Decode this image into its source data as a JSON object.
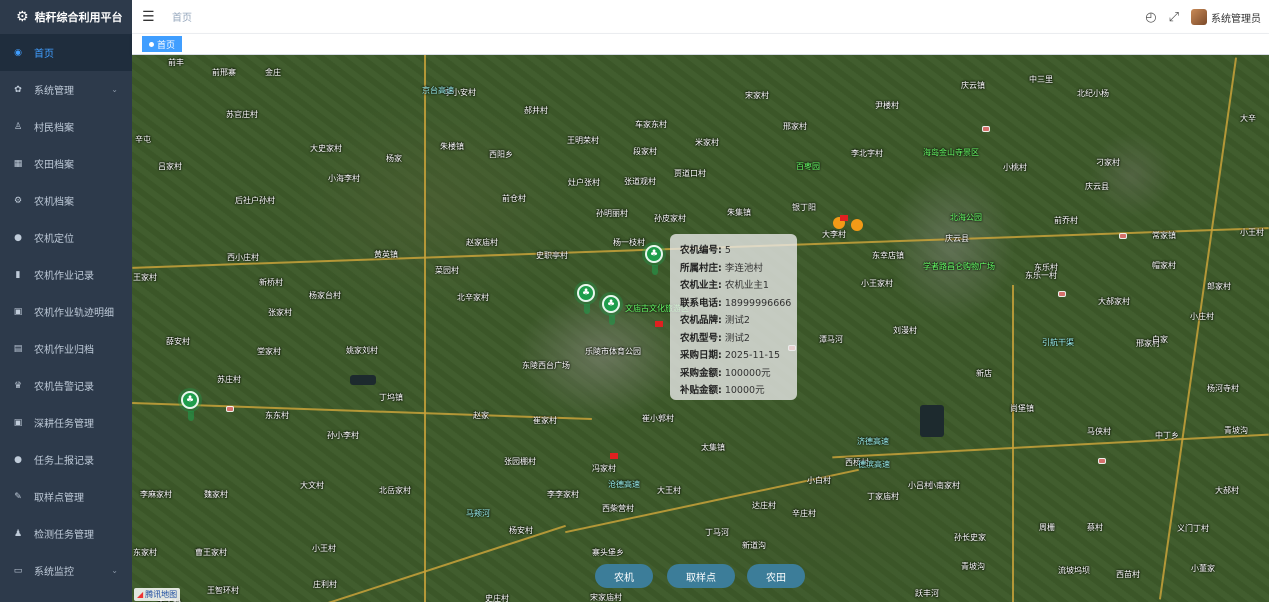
{
  "app": {
    "title": "秸秆综合利用平台"
  },
  "sidebar": {
    "items": [
      {
        "label": "首页",
        "icon": "dashboard-icon"
      },
      {
        "label": "系统管理",
        "icon": "gear-icon",
        "has_children": true
      },
      {
        "label": "村民档案",
        "icon": "user-icon"
      },
      {
        "label": "农田档案",
        "icon": "field-icon"
      },
      {
        "label": "农机档案",
        "icon": "tractor-icon"
      },
      {
        "label": "农机定位",
        "icon": "location-icon"
      },
      {
        "label": "农机作业记录",
        "icon": "chart-icon"
      },
      {
        "label": "农机作业轨迹明细",
        "icon": "clipboard-icon"
      },
      {
        "label": "农机作业归档",
        "icon": "book-icon"
      },
      {
        "label": "农机告警记录",
        "icon": "alarm-icon"
      },
      {
        "label": "深耕任务管理",
        "icon": "clipboard-icon"
      },
      {
        "label": "任务上报记录",
        "icon": "report-icon"
      },
      {
        "label": "取样点管理",
        "icon": "pin-icon"
      },
      {
        "label": "检测任务管理",
        "icon": "inspect-icon"
      },
      {
        "label": "系统监控",
        "icon": "monitor-icon",
        "has_children": true
      }
    ]
  },
  "header": {
    "breadcrumb": "首页",
    "username": "系统管理员"
  },
  "tags": [
    {
      "label": "首页"
    }
  ],
  "map": {
    "popup": {
      "rows": [
        {
          "k": "农机编号:",
          "v": "5"
        },
        {
          "k": "所属村庄:",
          "v": "李连池村"
        },
        {
          "k": "农机业主:",
          "v": "农机业主1"
        },
        {
          "k": "联系电话:",
          "v": "18999996666"
        },
        {
          "k": "农机品牌:",
          "v": "测试2"
        },
        {
          "k": "农机型号:",
          "v": "测试2"
        },
        {
          "k": "采购日期:",
          "v": "2025-11-15"
        },
        {
          "k": "采购金额:",
          "v": "100000元"
        },
        {
          "k": "补贴金额:",
          "v": "10000元"
        }
      ]
    },
    "buttons": {
      "machine": "农机",
      "sample": "取样点",
      "field": "农田"
    },
    "provider_logo": "腾讯地图",
    "places": [
      [
        "前丰",
        36,
        2
      ],
      [
        "前邢寨",
        80,
        12
      ],
      [
        "金庄",
        133,
        12
      ],
      [
        "李小安村",
        312,
        32
      ],
      [
        "郝井村",
        392,
        50
      ],
      [
        "苏官庄村",
        94,
        54
      ],
      [
        "车家东村",
        503,
        64
      ],
      [
        "辛屯",
        3,
        79
      ],
      [
        "大史家村",
        178,
        88
      ],
      [
        "杨家",
        254,
        98
      ],
      [
        "朱楼镇",
        308,
        86
      ],
      [
        "西阳乡",
        357,
        94
      ],
      [
        "王明荣村",
        435,
        80
      ],
      [
        "段家村",
        501,
        91
      ],
      [
        "贾道口村",
        542,
        113
      ],
      [
        "吕家村",
        26,
        106
      ],
      [
        "小海李村",
        196,
        118
      ],
      [
        "灶户张村",
        436,
        122
      ],
      [
        "张道观村",
        492,
        121
      ],
      [
        "后社户孙村",
        103,
        140
      ],
      [
        "前仓村",
        370,
        138
      ],
      [
        "孙明丽村",
        464,
        153
      ],
      [
        "孙皮家村",
        522,
        158
      ],
      [
        "朱集镇",
        595,
        152
      ],
      [
        "银丁阳",
        660,
        147
      ],
      [
        "大李村",
        690,
        174
      ],
      [
        "赵家庙村",
        334,
        182
      ],
      [
        "史职亭村",
        404,
        195
      ],
      [
        "杨一枝村",
        481,
        182
      ],
      [
        "黄英镇",
        242,
        194
      ],
      [
        "西小庄村",
        95,
        197
      ],
      [
        "菜园村",
        303,
        210
      ],
      [
        "北辛家村",
        325,
        237
      ],
      [
        "杨家台村",
        177,
        235
      ],
      [
        "新桥村",
        127,
        222
      ],
      [
        "王家村",
        1,
        217
      ],
      [
        "张家村",
        136,
        252
      ],
      [
        "薛安村",
        34,
        281
      ],
      [
        "堂家村",
        125,
        291
      ],
      [
        "姚家刘村",
        214,
        290
      ],
      [
        "苏庄村",
        85,
        319
      ],
      [
        "丁坞镇",
        247,
        337
      ],
      [
        "赵家",
        341,
        355
      ],
      [
        "崔家村",
        401,
        360
      ],
      [
        "崔小郭村",
        510,
        358
      ],
      [
        "东东村",
        133,
        355
      ],
      [
        "孙小李村",
        195,
        375
      ],
      [
        "张园棚村",
        372,
        401
      ],
      [
        "冯家村",
        460,
        408
      ],
      [
        "大文村",
        168,
        425
      ],
      [
        "北岳家村",
        247,
        430
      ],
      [
        "李李家村",
        415,
        434
      ],
      [
        "西柴营村",
        470,
        448
      ],
      [
        "杨安村",
        377,
        470
      ],
      [
        "寨头堡乡",
        460,
        492
      ],
      [
        "李麻家村",
        8,
        434
      ],
      [
        "魏家村",
        72,
        434
      ],
      [
        "小王村",
        180,
        488
      ],
      [
        "庄利村",
        181,
        524
      ],
      [
        "曹王家村",
        63,
        492
      ],
      [
        "王智环村",
        75,
        530
      ],
      [
        "东家村",
        1,
        492
      ],
      [
        "宋家庙村",
        458,
        537
      ],
      [
        "史庄村",
        353,
        538
      ],
      [
        "丰王村",
        25,
        543
      ],
      [
        "太集镇",
        569,
        387
      ],
      [
        "达庄村",
        620,
        445
      ],
      [
        "大王村",
        525,
        430
      ],
      [
        "辛庄村",
        660,
        453
      ],
      [
        "小白村",
        675,
        420
      ],
      [
        "西桥村",
        713,
        402
      ],
      [
        "宋家村",
        613,
        35
      ],
      [
        "邢家村",
        651,
        66
      ],
      [
        "尹楼村",
        743,
        45
      ],
      [
        "李北字村",
        719,
        93
      ],
      [
        "米家村",
        563,
        82
      ],
      [
        "庆云镇",
        829,
        25
      ],
      [
        "北纪小杨",
        945,
        33
      ],
      [
        "小桃村",
        871,
        107
      ],
      [
        "刁家村",
        964,
        102
      ],
      [
        "庆云县",
        953,
        126
      ],
      [
        "前乔村",
        922,
        160
      ],
      [
        "东幸店镇",
        740,
        195
      ],
      [
        "小王家村",
        729,
        223
      ],
      [
        "刘漫村",
        761,
        270
      ],
      [
        "庆云县",
        813,
        178
      ],
      [
        "潭马河",
        687,
        279
      ],
      [
        "东乐村",
        902,
        207
      ],
      [
        "大郝家村",
        966,
        241
      ],
      [
        "小庄村",
        1058,
        256
      ],
      [
        "邢家村",
        1004,
        283
      ],
      [
        "白家",
        1020,
        279
      ],
      [
        "新店",
        844,
        313
      ],
      [
        "尚堡镇",
        878,
        348
      ],
      [
        "马侠村",
        955,
        371
      ],
      [
        "中丁乡",
        1023,
        375
      ],
      [
        "杨河寺村",
        1075,
        328
      ],
      [
        "小吕村",
        776,
        425
      ],
      [
        "小南家村",
        796,
        425
      ],
      [
        "丁家庙村",
        735,
        436
      ],
      [
        "大郝村",
        1083,
        430
      ],
      [
        "周栅",
        907,
        467
      ],
      [
        "蔡村",
        955,
        467
      ],
      [
        "孙长史家",
        822,
        477
      ],
      [
        "义门丁村",
        1045,
        468
      ],
      [
        "青坡沟",
        829,
        506
      ],
      [
        "流坡坞坝",
        926,
        510
      ],
      [
        "西苗村",
        984,
        514
      ],
      [
        "小董家",
        1059,
        508
      ],
      [
        "跃丰河",
        783,
        533
      ],
      [
        "常家镇",
        1020,
        175
      ],
      [
        "帽家村",
        1020,
        205
      ],
      [
        "郎家村",
        1075,
        226
      ],
      [
        "小王村",
        1108,
        172
      ],
      [
        "大辛",
        1108,
        58
      ],
      [
        "丁马河",
        573,
        472
      ],
      [
        "新道沟",
        610,
        485
      ],
      [
        "乐陵市体育公园",
        453,
        291
      ],
      [
        "东陵西台广场",
        390,
        305
      ],
      [
        "中三里",
        897,
        19
      ],
      [
        "青坡沟",
        1092,
        370
      ],
      [
        "东乐一村",
        893,
        215
      ]
    ],
    "poi_labels": [
      [
        "文庙古文化旅游区",
        493,
        248
      ],
      [
        "百枣园",
        664,
        106
      ],
      [
        "北海公园",
        818,
        157
      ],
      [
        "海岛金山寺景区",
        791,
        92
      ],
      [
        "学者路昌仑购物广场",
        791,
        206
      ]
    ],
    "road_labels": [
      [
        "京台高速",
        290,
        30
      ],
      [
        "沧德高速",
        476,
        424
      ],
      [
        "济德高速",
        725,
        381
      ],
      [
        "马颊河",
        334,
        453
      ],
      [
        "德滨高速",
        726,
        404
      ],
      [
        "引航干渠",
        910,
        282
      ]
    ]
  }
}
